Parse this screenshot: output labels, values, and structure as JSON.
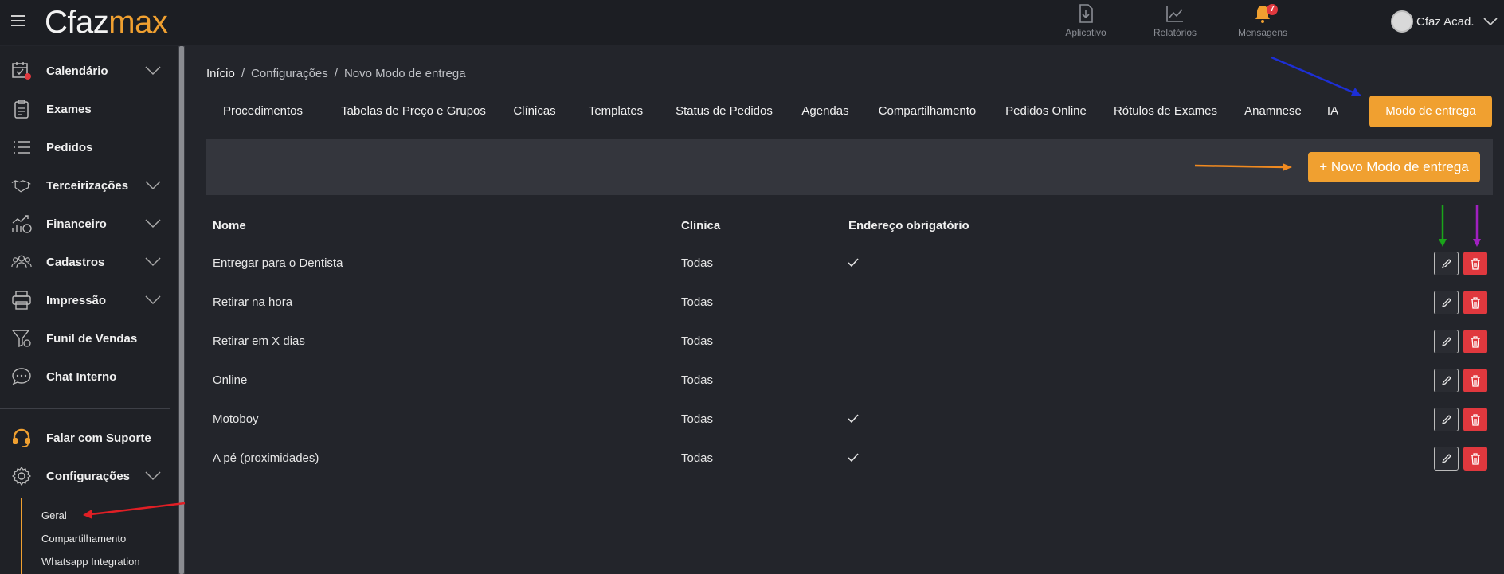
{
  "app": {
    "logo_part1": "Cfaz",
    "logo_part2": "max"
  },
  "topnav": [
    {
      "label": "Aplicativo",
      "icon": "download-app-icon"
    },
    {
      "label": "Relatórios",
      "icon": "chart-line-icon"
    },
    {
      "label": "Mensagens",
      "icon": "bell-icon",
      "badge": "7"
    }
  ],
  "user": {
    "name": "Cfaz Acad."
  },
  "sidebar": {
    "items": [
      {
        "label": "Calendário",
        "icon": "calendar-icon"
      },
      {
        "label": "Exames",
        "icon": "clipboard-icon"
      },
      {
        "label": "Pedidos",
        "icon": "list-icon"
      },
      {
        "label": "Terceirizações",
        "icon": "handshake-icon"
      },
      {
        "label": "Financeiro",
        "icon": "finance-icon"
      },
      {
        "label": "Cadastros",
        "icon": "users-icon"
      },
      {
        "label": "Impressão",
        "icon": "printer-icon"
      },
      {
        "label": "Funil de Vendas",
        "icon": "funnel-icon"
      },
      {
        "label": "Chat Interno",
        "icon": "chat-icon"
      },
      {
        "label": "Falar com Suporte",
        "icon": "headset-icon"
      },
      {
        "label": "Configurações",
        "icon": "gear-icon"
      }
    ],
    "sub_items": [
      "Geral",
      "Compartilhamento",
      "Whatsapp Integration"
    ]
  },
  "breadcrumb": [
    "Início",
    "Configurações",
    "Novo Modo de entrega"
  ],
  "tabs": [
    "Procedimentos",
    "Tabelas de Preço e Grupos",
    "Clínicas",
    "Templates",
    "Status de Pedidos",
    "Agendas",
    "Compartilhamento",
    "Pedidos Online",
    "Rótulos de Exames",
    "Anamnese",
    "IA",
    "Modo de entrega"
  ],
  "active_tab": "Modo de entrega",
  "new_button": "+ Novo Modo de entrega",
  "table": {
    "columns": [
      "Nome",
      "Clinica",
      "Endereço obrigatório"
    ],
    "rows": [
      {
        "nome": "Entregar para o Dentista",
        "clinica": "Todas",
        "endereco": true
      },
      {
        "nome": "Retirar na hora",
        "clinica": "Todas",
        "endereco": false
      },
      {
        "nome": "Retirar em X dias",
        "clinica": "Todas",
        "endereco": false
      },
      {
        "nome": "Online",
        "clinica": "Todas",
        "endereco": false
      },
      {
        "nome": "Motoboy",
        "clinica": "Todas",
        "endereco": true
      },
      {
        "nome": "A pé (proximidades)",
        "clinica": "Todas",
        "endereco": true
      }
    ]
  },
  "colors": {
    "accent": "#f0a030",
    "danger": "#e0383e",
    "background": "#23252b",
    "sidebar": "#1f2126"
  }
}
